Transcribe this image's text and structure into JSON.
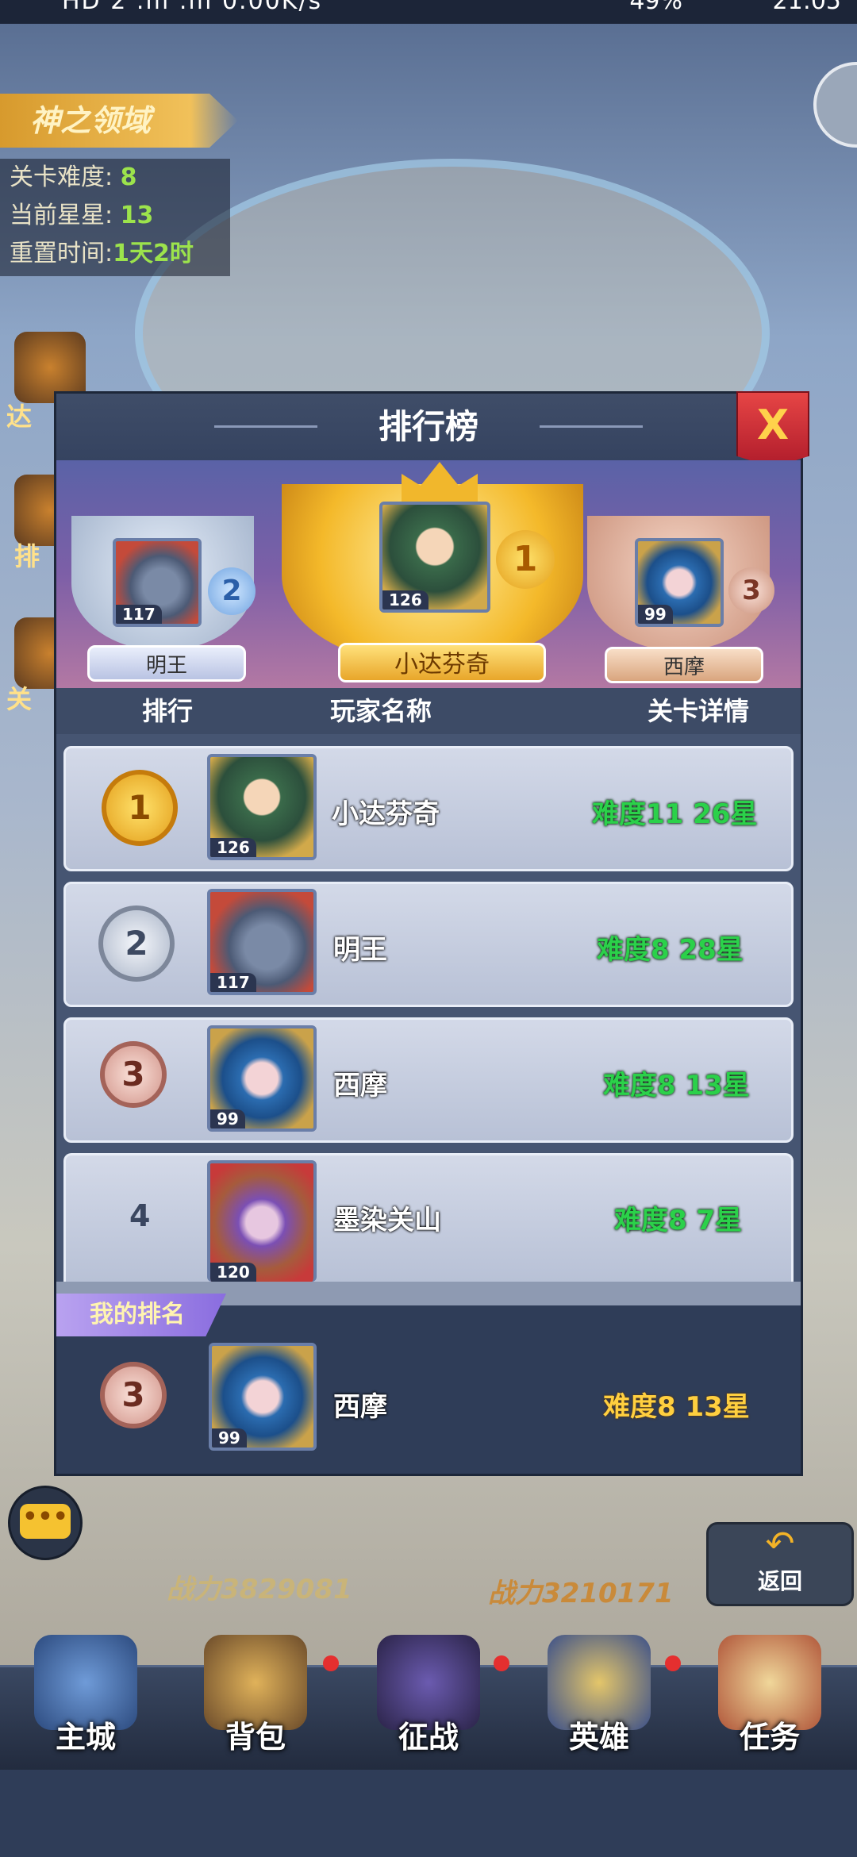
{
  "status_bar": {
    "left": "HD 2 .ıll .ıll 0.00K/s",
    "right": "49%",
    "time": "21:05"
  },
  "background": {
    "domain_title": "神之领域",
    "info": [
      {
        "label": "关卡难度:",
        "value": "8"
      },
      {
        "label": "当前星星:",
        "value": "13"
      },
      {
        "label": "重置时间:",
        "value": "1天2时"
      }
    ],
    "side_labels": [
      "达",
      "排",
      "关"
    ],
    "power_left": "战力3829081",
    "power_right": "战力3210171",
    "return_label": "返回"
  },
  "panel": {
    "title": "排行榜",
    "close_label": "X",
    "podium": [
      {
        "place": "2",
        "name": "明王",
        "level": "117"
      },
      {
        "place": "1",
        "name": "小达芬奇",
        "level": "126"
      },
      {
        "place": "3",
        "name": "西摩",
        "level": "99"
      }
    ],
    "columns": {
      "rank": "排行",
      "player": "玩家名称",
      "detail": "关卡详情"
    },
    "rows": [
      {
        "rank": "1",
        "level": "126",
        "name": "小达芬奇",
        "detail": "难度11  26星"
      },
      {
        "rank": "2",
        "level": "117",
        "name": "明王",
        "detail": "难度8  28星"
      },
      {
        "rank": "3",
        "level": "99",
        "name": "西摩",
        "detail": "难度8  13星"
      },
      {
        "rank": "4",
        "level": "120",
        "name": "墨染关山",
        "detail": "难度8  7星"
      }
    ],
    "my_rank": {
      "tag": "我的排名",
      "rank": "3",
      "level": "99",
      "name": "西摩",
      "detail": "难度8  13星"
    }
  },
  "bottom_nav": [
    {
      "label": "主城"
    },
    {
      "label": "背包"
    },
    {
      "label": "征战"
    },
    {
      "label": "英雄"
    },
    {
      "label": "任务"
    }
  ]
}
